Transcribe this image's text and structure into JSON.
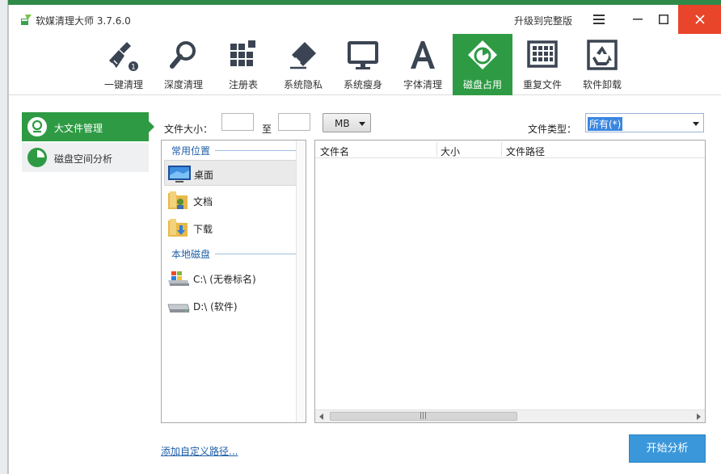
{
  "window": {
    "title": "软媒清理大师 3.7.6.0",
    "upgrade_label": "升级到完整版"
  },
  "toolbar": {
    "items": [
      {
        "label": "一键清理",
        "icon": "broom-icon"
      },
      {
        "label": "深度清理",
        "icon": "magnifier-icon"
      },
      {
        "label": "注册表",
        "icon": "registry-blocks-icon"
      },
      {
        "label": "系统隐私",
        "icon": "privacy-eraser-icon"
      },
      {
        "label": "系统瘦身",
        "icon": "monitor-icon"
      },
      {
        "label": "字体清理",
        "icon": "font-a-icon"
      },
      {
        "label": "磁盘占用",
        "icon": "disk-usage-icon"
      },
      {
        "label": "重复文件",
        "icon": "duplicate-grid-icon"
      },
      {
        "label": "软件卸载",
        "icon": "recycle-icon"
      }
    ],
    "active_index": 6,
    "active_color": "#2e9b44"
  },
  "sidebar": {
    "items": [
      {
        "label": "大文件管理",
        "active": true
      },
      {
        "label": "磁盘空间分析",
        "active": false
      }
    ]
  },
  "filters": {
    "size_label": "文件大小：",
    "min_value": "",
    "to_label": "至",
    "max_value": "",
    "unit": "MB",
    "type_label": "文件类型：",
    "type_value": "所有(*)"
  },
  "locations": {
    "common_title": "常用位置",
    "common": [
      {
        "label": "桌面",
        "icon": "desktop-icon",
        "selected": true
      },
      {
        "label": "文档",
        "icon": "documents-folder-icon",
        "selected": false
      },
      {
        "label": "下载",
        "icon": "downloads-folder-icon",
        "selected": false
      }
    ],
    "local_title": "本地磁盘",
    "drives": [
      {
        "label": "C:\\ (无卷标名)",
        "icon": "system-drive-icon"
      },
      {
        "label": "D:\\ (软件)",
        "icon": "hard-drive-icon"
      }
    ]
  },
  "table": {
    "columns": [
      "文件名",
      "大小",
      "文件路径"
    ],
    "rows": []
  },
  "actions": {
    "add_path_label": "添加自定义路径...",
    "start_label": "开始分析"
  }
}
